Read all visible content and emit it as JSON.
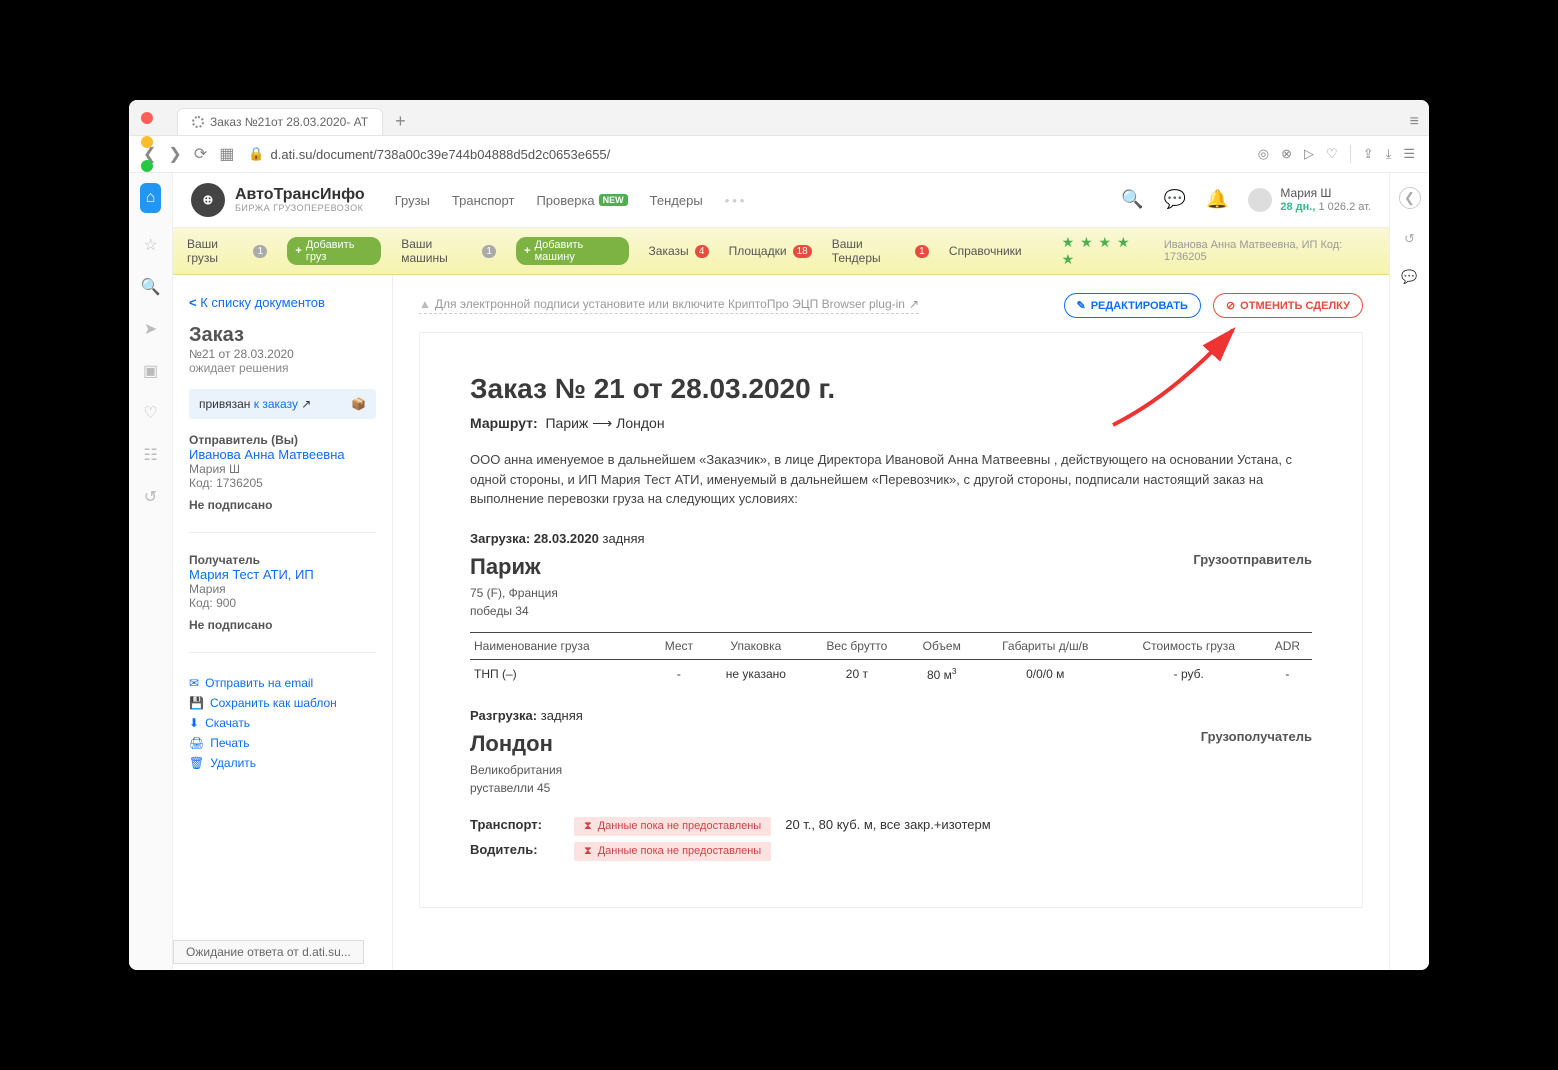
{
  "browser": {
    "tab_title": "Заказ №21от 28.03.2020- АТ",
    "url": "d.ati.su/document/738a00c39e744b04888d5d2c0653e655/",
    "status": "Ожидание ответа от d.ati.su..."
  },
  "brand": {
    "name": "АвтоТрансИнфо",
    "sub": "БИРЖА ГРУЗОПЕРЕВОЗОК"
  },
  "nav": {
    "cargo": "Грузы",
    "transport": "Транспорт",
    "check": "Проверка",
    "tenders": "Тендеры",
    "new_badge": "NEW"
  },
  "user": {
    "name": "Мария Ш",
    "days": "28 дн.,",
    "rating": "1 026.2 ат."
  },
  "subnav": {
    "your_cargo": "Ваши грузы",
    "your_cargo_c": "1",
    "add_cargo": "Добавить груз",
    "your_trucks": "Ваши машины",
    "your_trucks_c": "1",
    "add_truck": "Добавить машину",
    "orders": "Заказы",
    "orders_c": "4",
    "platforms": "Площадки",
    "platforms_c": "18",
    "your_tenders": "Ваши Тендеры",
    "your_tenders_c": "1",
    "directory": "Справочники",
    "firm": "Иванова Анна Матвеевна, ИП  Код: 1736205"
  },
  "sidebar": {
    "back": "К списку документов",
    "heading": "Заказ",
    "num": "№21 от 28.03.2020",
    "status": "ожидает решения",
    "linked_pre": "привязан",
    "linked_link": "к заказу",
    "sender_head": "Отправитель (Вы)",
    "sender_name": "Иванова Анна Матвеевна",
    "sender_person": "Мария Ш",
    "sender_code": "Код: 1736205",
    "not_signed": "Не подписано",
    "recip_head": "Получатель",
    "recip_name": "Мария Тест АТИ, ИП",
    "recip_person": "Мария",
    "recip_code": "Код: 900",
    "actions": {
      "email": "Отправить на email",
      "save_tpl": "Сохранить как шаблон",
      "download": "Скачать",
      "print": "Печать",
      "delete": "Удалить"
    }
  },
  "toolbar": {
    "warning": "Для электронной подписи установите или включите КриптоПро ЭЦП Browser plug-in",
    "edit": "РЕДАКТИРОВАТЬ",
    "cancel": "ОТМЕНИТЬ СДЕЛКУ"
  },
  "doc": {
    "title": "Заказ №  21 от 28.03.2020 г.",
    "route_label": "Маршрут:",
    "route_from": "Париж",
    "route_to": "Лондон",
    "intro": "ООО анна именуемое в дальнейшем «Заказчик», в лице Директора Ивановой Анна Матвеевны , действующего на основании Устана, с одной стороны, и ИП Мария Тест АТИ, именуемый в дальнейшем «Перевозчик», с другой стороны, подписали настоящий заказ на выполнение перевозки груза на следующих условиях:",
    "load_label": "Загрузка:",
    "load_date": "28.03.2020",
    "load_type": "задняя",
    "consignor": "Грузоотправитель",
    "from_city": "Париж",
    "from_region": "75 (F), Франция",
    "from_addr": "победы 34",
    "unload_label": "Разгрузка:",
    "unload_type": "задняя",
    "consignee": "Грузополучатель",
    "to_city": "Лондон",
    "to_region": "Великобритания",
    "to_addr": "руставелли 45",
    "table_head": {
      "name": "Наименование груза",
      "places": "Мест",
      "pack": "Упаковка",
      "weight": "Вес брутто",
      "vol": "Объем",
      "dims": "Габариты д/ш/в",
      "cost": "Стоимость груза",
      "adr": "ADR"
    },
    "row": {
      "name": "ТНП (–)",
      "places": "-",
      "pack": "не указано",
      "weight": "20 т",
      "vol_num": "80 м",
      "vol_sup": "3",
      "dims": "0/0/0 м",
      "cost": "- руб.",
      "adr": "-"
    },
    "transport_label": "Транспорт:",
    "not_provided": "Данные пока не предоставлены",
    "transport_req": "20 т., 80 куб. м, все закр.+изотерм",
    "driver_label": "Водитель:"
  }
}
